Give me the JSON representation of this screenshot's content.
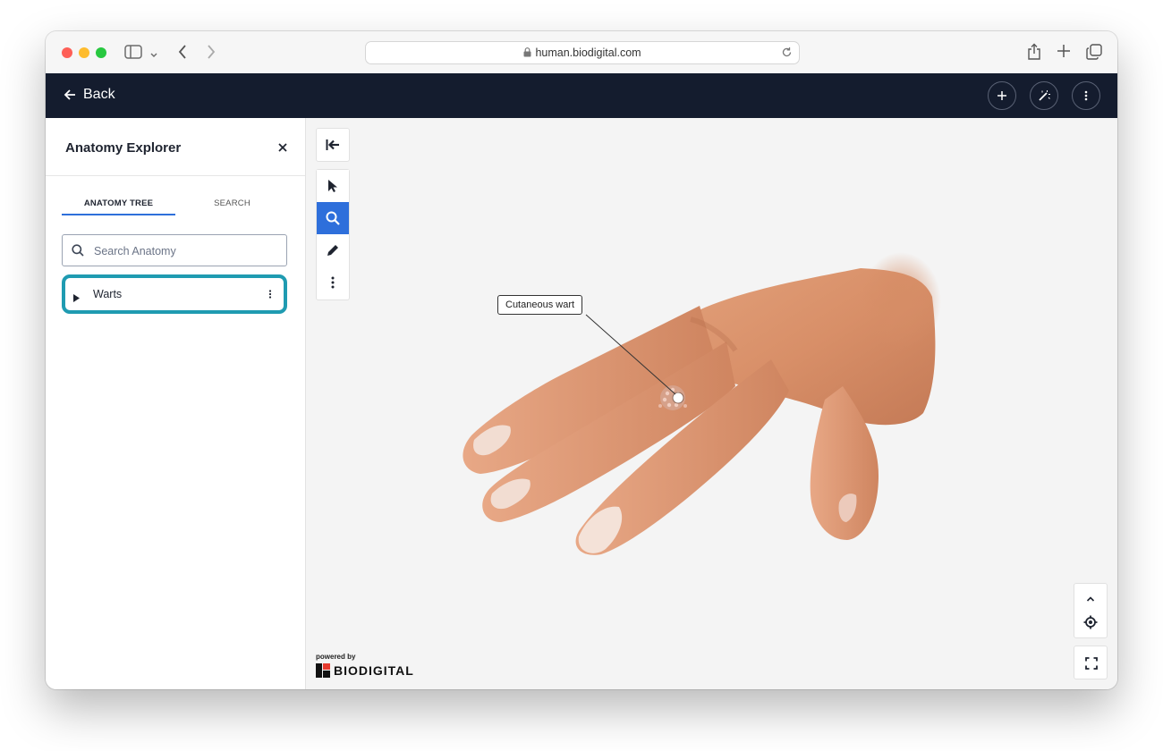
{
  "browser": {
    "url": "human.biodigital.com"
  },
  "header": {
    "back_label": "Back",
    "buttons": [
      {
        "icon": "plus-icon"
      },
      {
        "icon": "magic-wand-icon"
      },
      {
        "icon": "more-vertical-icon"
      }
    ]
  },
  "sidebar": {
    "title": "Anatomy Explorer",
    "tabs": [
      {
        "label": "ANATOMY TREE",
        "active": true
      },
      {
        "label": "SEARCH",
        "active": false
      }
    ],
    "search_placeholder": "Search Anatomy",
    "tree": [
      {
        "label": "Warts",
        "selected": true
      }
    ]
  },
  "viewer": {
    "annotation": "Cutaneous wart",
    "tools": [
      "collapse-panel-icon",
      "select-arrow-icon",
      "zoom-search-icon",
      "pen-icon",
      "more-vertical-icon"
    ],
    "powered_by": "powered by",
    "brand": "BIODIGITAL"
  },
  "colors": {
    "header_bg": "#141c2e",
    "accent_blue": "#2e6fdb",
    "selected_outline": "#1f9bb1",
    "skin": "#d8956e"
  }
}
